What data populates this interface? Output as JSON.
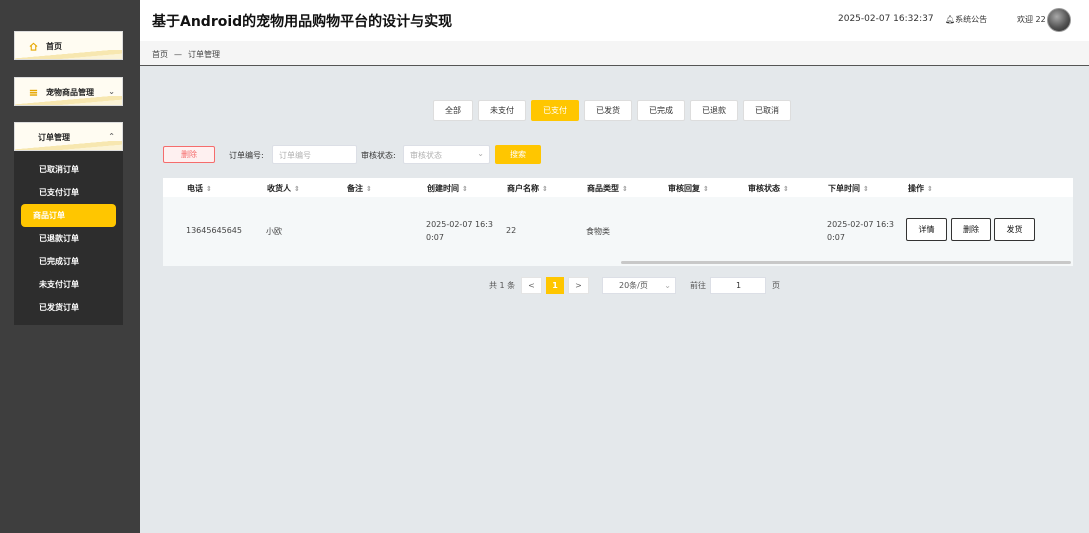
{
  "app": {
    "title": "基于Android的宠物用品购物平台的设计与实现"
  },
  "header": {
    "datetime": "2025-02-07 16:32:37",
    "notice": "系统公告",
    "welcome": "欢迎 22"
  },
  "breadcrumb": {
    "home": "首页",
    "separator": "—",
    "current": "订单管理"
  },
  "sidebar": {
    "home": "首页",
    "pet_goods": "宠物商品管理",
    "orders": "订单管理",
    "sub_items": [
      {
        "label": "已取消订单"
      },
      {
        "label": "已支付订单"
      },
      {
        "label": "商品订单",
        "active": true
      },
      {
        "label": "已退款订单"
      },
      {
        "label": "已完成订单"
      },
      {
        "label": "未支付订单"
      },
      {
        "label": "已发货订单"
      }
    ]
  },
  "tabs": [
    {
      "label": "全部"
    },
    {
      "label": "未支付"
    },
    {
      "label": "已支付",
      "active": true
    },
    {
      "label": "已发货"
    },
    {
      "label": "已完成"
    },
    {
      "label": "已退款"
    },
    {
      "label": "已取消"
    }
  ],
  "filter": {
    "delete": "删除",
    "order_no_label": "订单编号:",
    "order_no_placeholder": "订单编号",
    "status_label": "审核状态:",
    "status_placeholder": "审核状态",
    "search": "搜索"
  },
  "table": {
    "columns": [
      "电话",
      "收货人",
      "备注",
      "创建时间",
      "商户名称",
      "商品类型",
      "审核回复",
      "审核状态",
      "下单时间",
      "操作"
    ],
    "rows": [
      {
        "phone": "13645645645",
        "receiver": "小欧",
        "note": "",
        "created": "2025-02-07 16:30:07",
        "merchant": "22",
        "type": "食物类",
        "reply": "",
        "status": "",
        "ordered": "2025-02-07 16:30:07"
      }
    ],
    "actions": {
      "detail": "详情",
      "delete": "删除",
      "ship": "发货"
    }
  },
  "pagination": {
    "total": "共 1 条",
    "prev": "<",
    "current": "1",
    "next": ">",
    "page_size": "20条/页",
    "goto": "前往",
    "goto_value": "1",
    "page_unit": "页"
  },
  "colors": {
    "accent": "#ffc600",
    "sidebar_bg": "#3e3e3e",
    "danger": "#f56c6c"
  }
}
